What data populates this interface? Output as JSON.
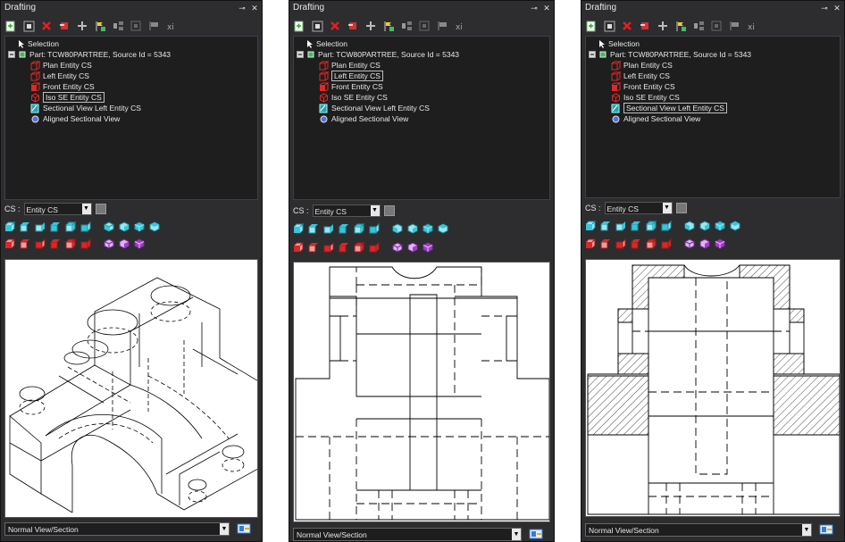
{
  "panels": [
    {
      "title": "Drafting",
      "tree": {
        "selection_label": "Selection",
        "part_label": "Part: TCW80PARTREE, Source Id = 5343",
        "items": [
          {
            "label": "Plan Entity CS",
            "selected": false,
            "icon": "cube-red-outline"
          },
          {
            "label": "Left Entity CS",
            "selected": false,
            "icon": "cube-red-outline"
          },
          {
            "label": "Front Entity CS",
            "selected": false,
            "icon": "cube-red-solid"
          },
          {
            "label": "Iso SE Entity CS",
            "selected": true,
            "icon": "cube-iso"
          },
          {
            "label": "Sectional View Left Entity CS",
            "selected": false,
            "icon": "section-view"
          },
          {
            "label": "Aligned Sectional View",
            "selected": false,
            "icon": "aligned-section"
          }
        ]
      },
      "cs_label": "CS :",
      "cs_value": "Entity CS",
      "view_mode": "Normal View/Section"
    },
    {
      "title": "Drafting",
      "tree": {
        "selection_label": "Selection",
        "part_label": "Part: TCW80PARTREE, Source Id = 5343",
        "items": [
          {
            "label": "Plan Entity CS",
            "selected": false,
            "icon": "cube-red-outline"
          },
          {
            "label": "Left Entity CS",
            "selected": true,
            "icon": "cube-red-outline"
          },
          {
            "label": "Front Entity CS",
            "selected": false,
            "icon": "cube-red-solid"
          },
          {
            "label": "Iso SE Entity CS",
            "selected": false,
            "icon": "cube-iso"
          },
          {
            "label": "Sectional View Left Entity CS",
            "selected": false,
            "icon": "section-view"
          },
          {
            "label": "Aligned Sectional View",
            "selected": false,
            "icon": "aligned-section"
          }
        ]
      },
      "cs_label": "CS :",
      "cs_value": "Entity CS",
      "view_mode": "Normal View/Section"
    },
    {
      "title": "Drafting",
      "tree": {
        "selection_label": "Selection",
        "part_label": "Part: TCW80PARTREE, Source Id = 5343",
        "items": [
          {
            "label": "Plan Entity CS",
            "selected": false,
            "icon": "cube-red-outline"
          },
          {
            "label": "Left Entity CS",
            "selected": false,
            "icon": "cube-red-outline"
          },
          {
            "label": "Front Entity CS",
            "selected": false,
            "icon": "cube-red-solid"
          },
          {
            "label": "Iso SE Entity CS",
            "selected": false,
            "icon": "cube-iso"
          },
          {
            "label": "Sectional View Left Entity CS",
            "selected": true,
            "icon": "section-view"
          },
          {
            "label": "Aligned Sectional View",
            "selected": false,
            "icon": "aligned-section"
          }
        ]
      },
      "cs_label": "CS :",
      "cs_value": "Entity CS",
      "view_mode": "Normal View/Section"
    }
  ],
  "viewports": [
    "isometric-view",
    "left-view",
    "left-sectional-view"
  ],
  "colors": {
    "panel_bg": "#2d2d30",
    "tree_bg": "#1e1e1e",
    "cyan_cube": "#36c6d8",
    "red_cube": "#d82828",
    "purple_cube": "#a43cc8"
  }
}
